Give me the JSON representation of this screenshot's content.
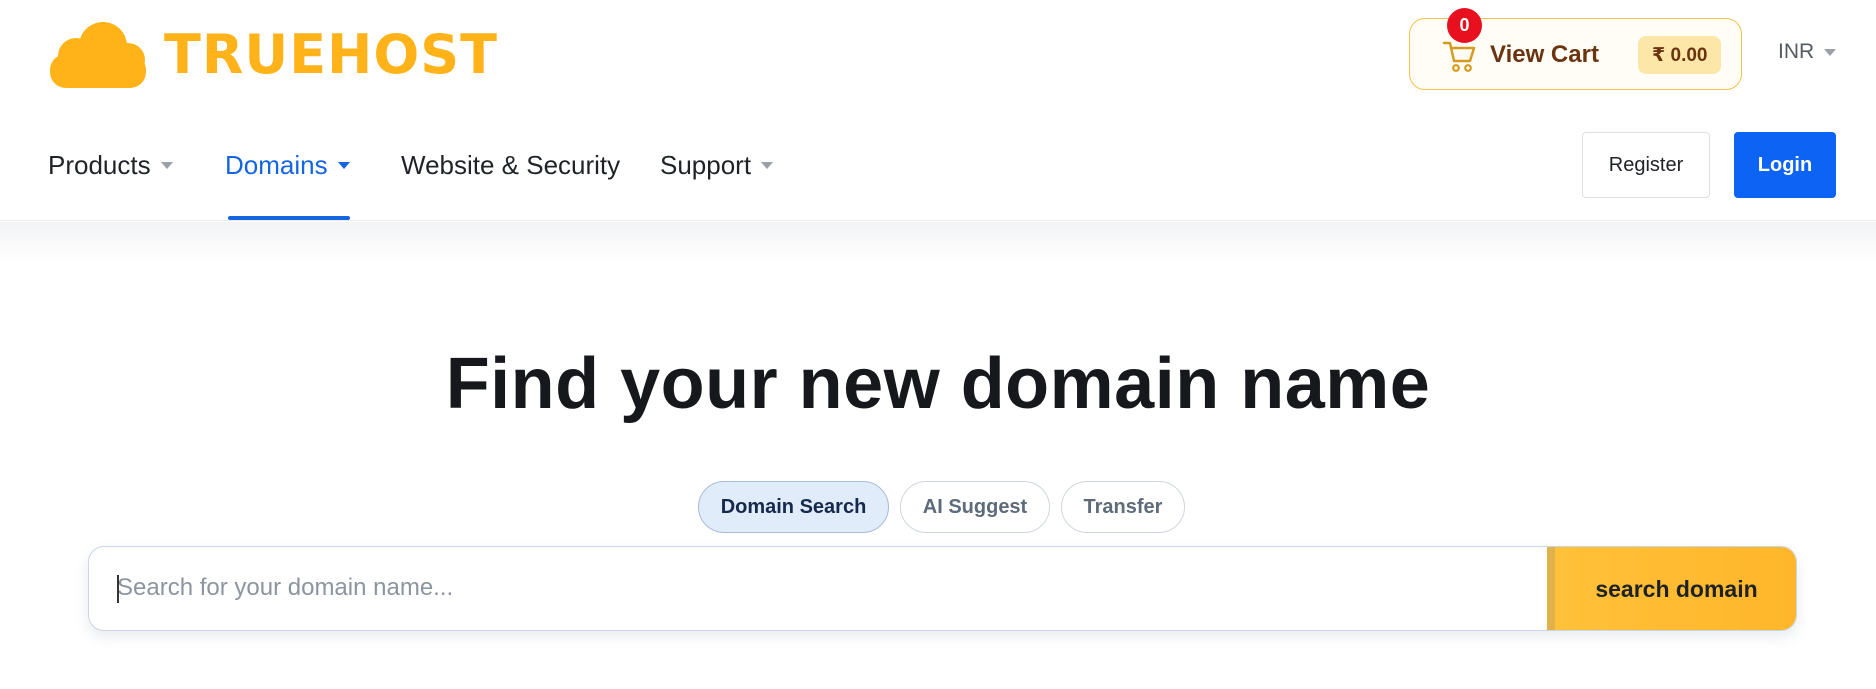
{
  "brand": {
    "name": "TRUEHOST",
    "color": "#ffb319"
  },
  "cart": {
    "count": "0",
    "label": "View Cart",
    "total": "₹ 0.00"
  },
  "currency": {
    "selected": "INR"
  },
  "nav": {
    "products": "Products",
    "domains": "Domains",
    "website_security": "Website & Security",
    "support": "Support",
    "active": "Domains"
  },
  "auth": {
    "register": "Register",
    "login": "Login"
  },
  "hero": {
    "title": "Find your new domain name"
  },
  "search_tabs": [
    "Domain Search",
    "AI Suggest",
    "Transfer"
  ],
  "search": {
    "placeholder": "Search for your domain name...",
    "value": "",
    "button": "search domain"
  },
  "colors": {
    "accent": "#0d63f4",
    "cta": "#ffc13a",
    "badge": "#e8101e"
  },
  "icons": [
    "cloud-logo-icon",
    "cart-icon",
    "chevron-down-icon"
  ]
}
